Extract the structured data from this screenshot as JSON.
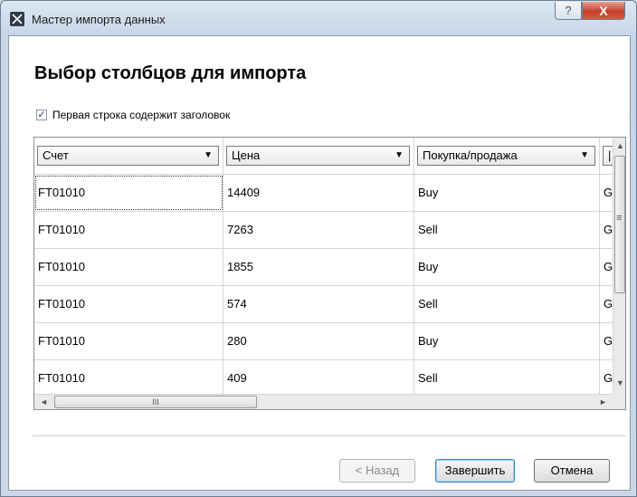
{
  "window": {
    "title": "Мастер импорта данных",
    "help_glyph": "?",
    "close_glyph": "X"
  },
  "page": {
    "heading": "Выбор столбцов для импорта",
    "first_row_header": {
      "label": "Первая строка содержит заголовок",
      "checked": true,
      "check_glyph": "✓"
    }
  },
  "table": {
    "columns": [
      {
        "label": "Счет",
        "arrow": "▼"
      },
      {
        "label": "Цена",
        "arrow": "▼"
      },
      {
        "label": "Покупка/продажа",
        "arrow": "▼"
      },
      {
        "label": "|",
        "arrow": ""
      }
    ],
    "rows": [
      [
        "FT01010",
        "14409",
        "Buy",
        "G"
      ],
      [
        "FT01010",
        "7263",
        "Sell",
        "G"
      ],
      [
        "FT01010",
        "1855",
        "Buy",
        "G"
      ],
      [
        "FT01010",
        "574",
        "Sell",
        "G"
      ],
      [
        "FT01010",
        "280",
        "Buy",
        "G"
      ],
      [
        "FT01010",
        "409",
        "Sell",
        "G"
      ]
    ],
    "scroll": {
      "up": "▲",
      "down": "▼",
      "left": "◄",
      "right": "►",
      "v_grip": "≡",
      "h_grip": "III"
    }
  },
  "buttons": {
    "back": "< Назад",
    "finish": "Завершить",
    "cancel": "Отмена"
  },
  "colors": {
    "close_button": "#c7402c",
    "checkbox_mark": "#1e3f73",
    "default_button_border": "#3c7fb1"
  }
}
